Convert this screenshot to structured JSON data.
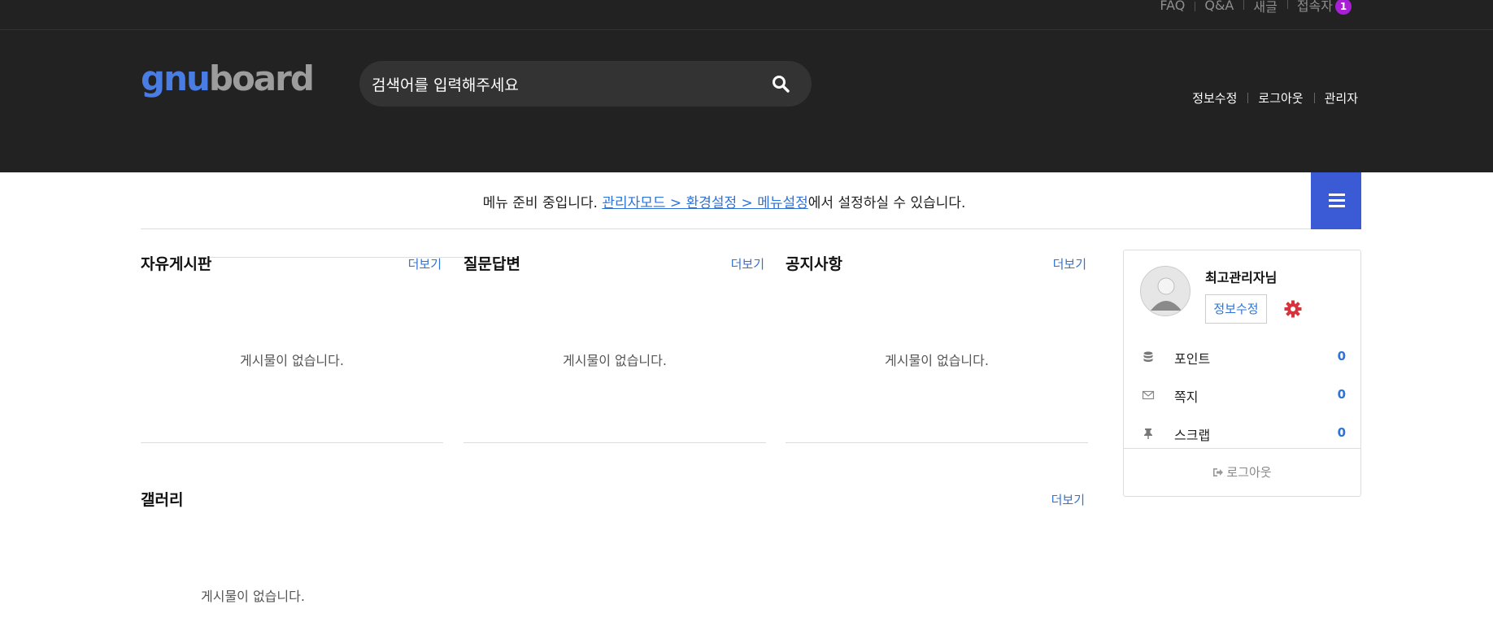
{
  "topbar": {
    "links": [
      "FAQ",
      "Q&A",
      "새글",
      "접속자"
    ],
    "visitor_count": "1"
  },
  "header": {
    "logo_part1": "gnu",
    "logo_part2": "board",
    "search_placeholder": "검색어를 입력해주세요",
    "links": [
      "정보수정",
      "로그아웃",
      "관리자"
    ]
  },
  "menu": {
    "text_before": "메뉴 준비 중입니다. ",
    "link_text": "관리자모드 > 환경설정 > 메뉴설정",
    "text_after": "에서 설정하실 수 있습니다."
  },
  "boards": [
    {
      "title": "자유게시판",
      "more": "더보기",
      "empty": "게시물이 없습니다."
    },
    {
      "title": "질문답변",
      "more": "더보기",
      "empty": "게시물이 없습니다."
    },
    {
      "title": "공지사항",
      "more": "더보기",
      "empty": "게시물이 없습니다."
    }
  ],
  "gallery": {
    "title": "갤러리",
    "more": "더보기",
    "empty": "게시물이 없습니다."
  },
  "profile": {
    "name": "최고관리자님",
    "edit_label": "정보수정",
    "rows": [
      {
        "label": "포인트",
        "value": "0",
        "icon": "database-icon"
      },
      {
        "label": "쪽지",
        "value": "0",
        "icon": "envelope-icon"
      },
      {
        "label": "스크랩",
        "value": "0",
        "icon": "thumbtack-icon"
      }
    ],
    "logout_label": "로그아웃"
  },
  "colors": {
    "header_bg": "#222222",
    "accent_blue": "#3b5ad6",
    "link_blue": "#2e73d8",
    "badge_purple": "#a820d6",
    "gear_red": "#d8323c"
  }
}
